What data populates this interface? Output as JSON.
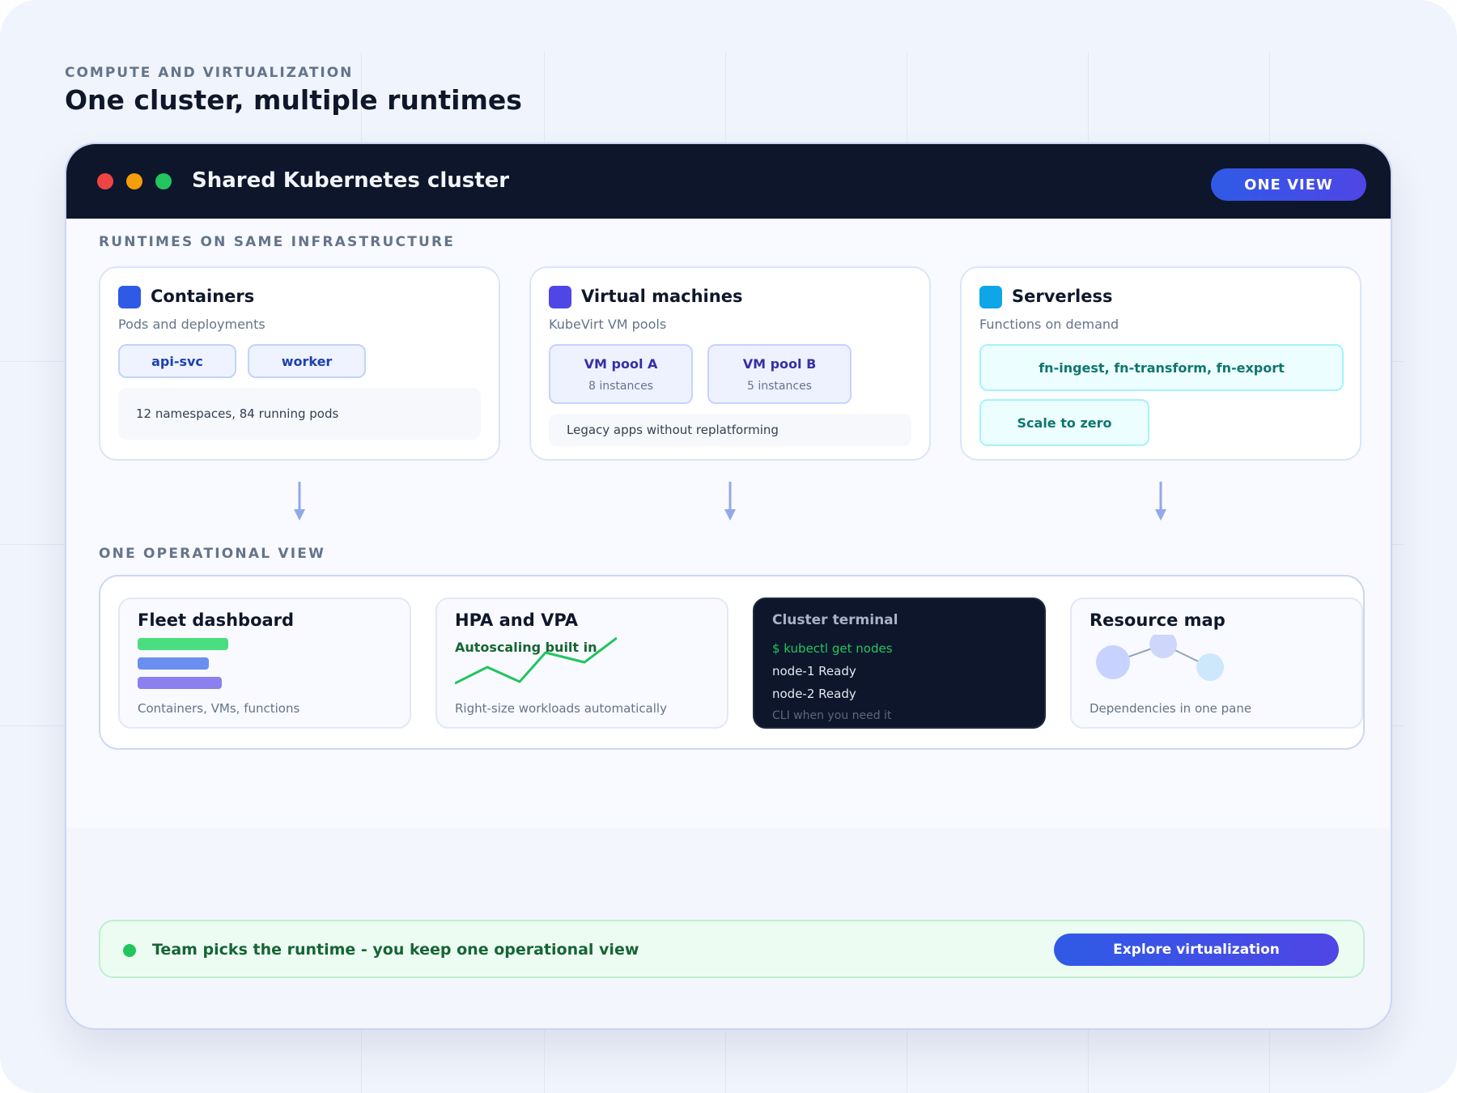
{
  "header": {
    "eyebrow": "COMPUTE AND VIRTUALIZATION",
    "title": "One cluster, multiple runtimes"
  },
  "window": {
    "title": "Shared Kubernetes cluster",
    "badge_label": "ONE VIEW",
    "dot_colors": [
      "#ef4444",
      "#f59e0b",
      "#22c55e"
    ]
  },
  "runtimes": {
    "section_label": "RUNTIMES ON SAME INFRASTRUCTURE",
    "containers": {
      "title": "Containers",
      "subtitle": "Pods and deployments",
      "chips": [
        "api-svc",
        "worker"
      ],
      "info": "12 namespaces, 84 running pods",
      "icon_color": "#2f5ae6"
    },
    "vms": {
      "title": "Virtual machines",
      "subtitle": "KubeVirt VM pools",
      "pools": [
        {
          "name": "VM pool A",
          "instances": "8 instances"
        },
        {
          "name": "VM pool B",
          "instances": "5 instances"
        }
      ],
      "info": "Legacy apps without replatforming",
      "icon_color": "#4f46e5"
    },
    "serverless": {
      "title": "Serverless",
      "subtitle": "Functions on demand",
      "functions": "fn-ingest, fn-transform, fn-export",
      "scale": "Scale to zero",
      "icon_color": "#0ea5e9"
    }
  },
  "operations": {
    "section_label": "ONE OPERATIONAL VIEW",
    "fleet": {
      "title": "Fleet dashboard",
      "subtitle": "Containers, VMs, functions"
    },
    "hpa": {
      "title": "HPA and VPA",
      "label": "Autoscaling built in",
      "subtitle": "Right-size workloads automatically"
    },
    "terminal": {
      "title": "Cluster terminal",
      "command": "$ kubectl get nodes",
      "lines": [
        "node-1 Ready",
        "node-2 Ready"
      ],
      "footer": "CLI when you need it"
    },
    "resource_map": {
      "title": "Resource map",
      "subtitle": "Dependencies in one pane"
    }
  },
  "banner": {
    "text": "Team picks the runtime - you keep one operational view",
    "button_label": "Explore virtualization"
  }
}
